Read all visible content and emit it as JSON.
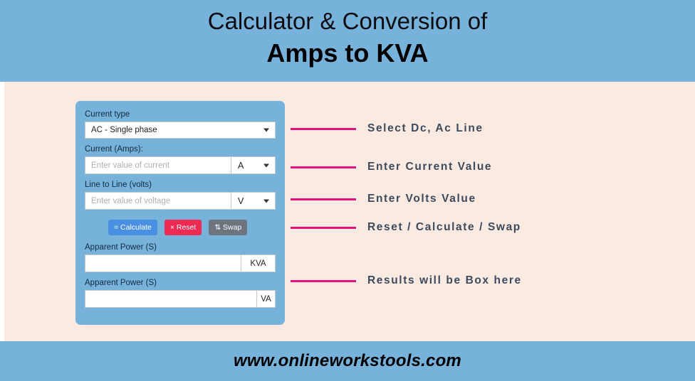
{
  "header": {
    "title_line_1": "Calculator & Conversion of",
    "title_line_2": "Amps to KVA",
    "background_color": "#76b2da"
  },
  "calculator": {
    "background_color": "#76b2da",
    "current_type": {
      "label": "Current type",
      "selected": "AC - Single phase"
    },
    "current": {
      "label": "Current (Amps):",
      "placeholder": "Enter value of current",
      "value": "",
      "unit": "A"
    },
    "voltage": {
      "label": "Line to Line (volts)",
      "placeholder": "Enter value of voltage",
      "value": "",
      "unit": "V"
    },
    "buttons": {
      "calculate": "= Calculate",
      "reset": "× Reset",
      "swap": "⇅ Swap",
      "calculate_color": "#4a90e2",
      "reset_color": "#ee2a52",
      "swap_color": "#6c757d"
    },
    "result_kva": {
      "label": "Apparent Power (S)",
      "value": "",
      "unit": "KVA"
    },
    "result_va": {
      "label": "Apparent Power (S)",
      "value": "",
      "unit": "VA"
    }
  },
  "annotations": {
    "line_color": "#e5127d",
    "text_color": "#3c4a5c",
    "items": [
      {
        "text": "Select Dc, Ac Line"
      },
      {
        "text": "Enter Current Value"
      },
      {
        "text": "Enter Volts Value"
      },
      {
        "text": "Reset / Calculate / Swap"
      },
      {
        "text": "Results will be Box here"
      }
    ]
  },
  "footer": {
    "text": "www.onlineworkstools.com",
    "background_color": "#76b2da"
  }
}
